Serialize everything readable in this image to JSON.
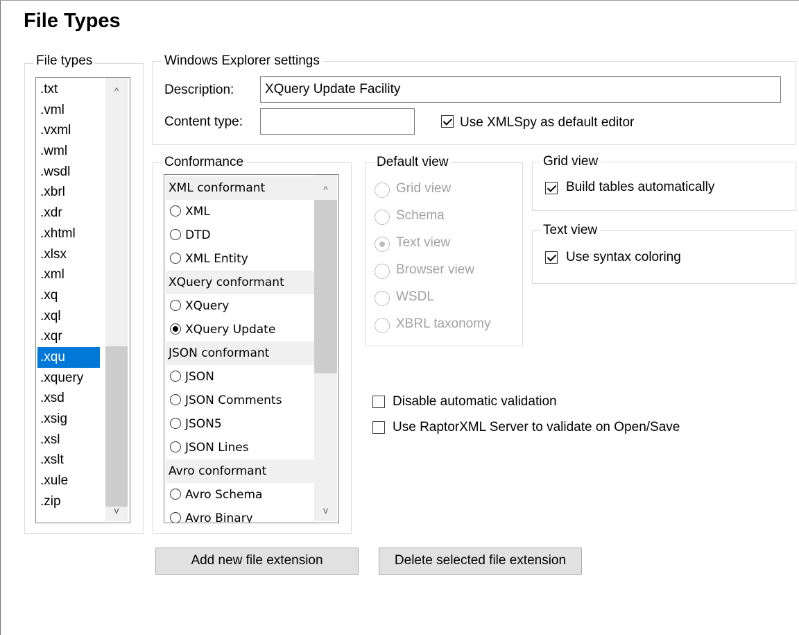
{
  "page": {
    "title": "File Types"
  },
  "file_types": {
    "legend": "File types",
    "items": [
      ".txt",
      ".vml",
      ".vxml",
      ".wml",
      ".wsdl",
      ".xbrl",
      ".xdr",
      ".xhtml",
      ".xlsx",
      ".xml",
      ".xq",
      ".xql",
      ".xqr",
      ".xqu",
      ".xquery",
      ".xsd",
      ".xsig",
      ".xsl",
      ".xslt",
      ".xule",
      ".zip"
    ],
    "selected": ".xqu",
    "scroll_up": "^",
    "scroll_down": "v"
  },
  "explorer": {
    "legend": "Windows Explorer settings",
    "description_label": "Description:",
    "description_value": "XQuery Update Facility",
    "content_type_label": "Content type:",
    "content_type_value": "",
    "default_editor_label": "Use XMLSpy as default editor",
    "default_editor_checked": true
  },
  "conformance": {
    "legend": "Conformance",
    "rows": [
      {
        "kind": "header",
        "label": "XML conformant"
      },
      {
        "kind": "radio",
        "label": "XML",
        "checked": false
      },
      {
        "kind": "radio",
        "label": "DTD",
        "checked": false
      },
      {
        "kind": "radio",
        "label": "XML Entity",
        "checked": false
      },
      {
        "kind": "header",
        "label": "XQuery conformant"
      },
      {
        "kind": "radio",
        "label": "XQuery",
        "checked": false
      },
      {
        "kind": "radio",
        "label": "XQuery Update",
        "checked": true
      },
      {
        "kind": "header",
        "label": "JSON conformant"
      },
      {
        "kind": "radio",
        "label": "JSON",
        "checked": false
      },
      {
        "kind": "radio",
        "label": "JSON Comments",
        "checked": false
      },
      {
        "kind": "radio",
        "label": "JSON5",
        "checked": false
      },
      {
        "kind": "radio",
        "label": "JSON Lines",
        "checked": false
      },
      {
        "kind": "header",
        "label": "Avro conformant"
      },
      {
        "kind": "radio",
        "label": "Avro Schema",
        "checked": false
      },
      {
        "kind": "radio",
        "label": "Avro Binary",
        "checked": false
      }
    ]
  },
  "default_view": {
    "legend": "Default view",
    "options": [
      {
        "label": "Grid view",
        "checked": false
      },
      {
        "label": "Schema",
        "checked": false
      },
      {
        "label": "Text view",
        "checked": true
      },
      {
        "label": "Browser view",
        "checked": false
      },
      {
        "label": "WSDL",
        "checked": false
      },
      {
        "label": "XBRL taxonomy",
        "checked": false
      }
    ]
  },
  "grid_view": {
    "legend": "Grid view",
    "option_label": "Build tables automatically",
    "checked": true
  },
  "text_view": {
    "legend": "Text view",
    "option_label": "Use syntax coloring",
    "checked": true
  },
  "validation": {
    "disable_label": "Disable automatic validation",
    "disable_checked": false,
    "raptor_label": "Use RaptorXML Server to validate on Open/Save",
    "raptor_checked": false
  },
  "buttons": {
    "add_label": "Add new file extension",
    "delete_label": "Delete selected file extension"
  },
  "colors": {
    "selection": "#0078d7",
    "group_border": "#dcdcdc",
    "button_face": "#e1e1e1"
  }
}
